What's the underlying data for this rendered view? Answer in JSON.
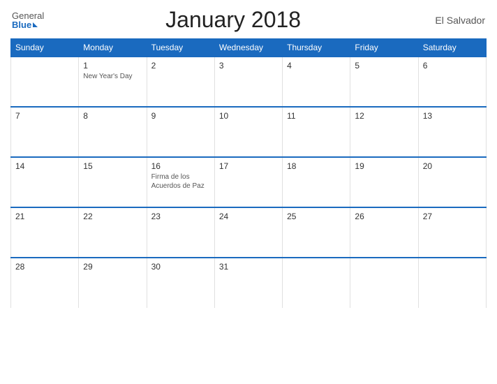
{
  "header": {
    "logo_general": "General",
    "logo_blue": "Blue",
    "title": "January 2018",
    "country": "El Salvador"
  },
  "days_of_week": [
    "Sunday",
    "Monday",
    "Tuesday",
    "Wednesday",
    "Thursday",
    "Friday",
    "Saturday"
  ],
  "weeks": [
    [
      {
        "day": "",
        "holiday": "",
        "empty": true
      },
      {
        "day": "1",
        "holiday": "New Year's Day",
        "empty": false
      },
      {
        "day": "2",
        "holiday": "",
        "empty": false
      },
      {
        "day": "3",
        "holiday": "",
        "empty": false
      },
      {
        "day": "4",
        "holiday": "",
        "empty": false
      },
      {
        "day": "5",
        "holiday": "",
        "empty": false
      },
      {
        "day": "6",
        "holiday": "",
        "empty": false
      }
    ],
    [
      {
        "day": "7",
        "holiday": "",
        "empty": false
      },
      {
        "day": "8",
        "holiday": "",
        "empty": false
      },
      {
        "day": "9",
        "holiday": "",
        "empty": false
      },
      {
        "day": "10",
        "holiday": "",
        "empty": false
      },
      {
        "day": "11",
        "holiday": "",
        "empty": false
      },
      {
        "day": "12",
        "holiday": "",
        "empty": false
      },
      {
        "day": "13",
        "holiday": "",
        "empty": false
      }
    ],
    [
      {
        "day": "14",
        "holiday": "",
        "empty": false
      },
      {
        "day": "15",
        "holiday": "",
        "empty": false
      },
      {
        "day": "16",
        "holiday": "Firma de los Acuerdos de Paz",
        "empty": false
      },
      {
        "day": "17",
        "holiday": "",
        "empty": false
      },
      {
        "day": "18",
        "holiday": "",
        "empty": false
      },
      {
        "day": "19",
        "holiday": "",
        "empty": false
      },
      {
        "day": "20",
        "holiday": "",
        "empty": false
      }
    ],
    [
      {
        "day": "21",
        "holiday": "",
        "empty": false
      },
      {
        "day": "22",
        "holiday": "",
        "empty": false
      },
      {
        "day": "23",
        "holiday": "",
        "empty": false
      },
      {
        "day": "24",
        "holiday": "",
        "empty": false
      },
      {
        "day": "25",
        "holiday": "",
        "empty": false
      },
      {
        "day": "26",
        "holiday": "",
        "empty": false
      },
      {
        "day": "27",
        "holiday": "",
        "empty": false
      }
    ],
    [
      {
        "day": "28",
        "holiday": "",
        "empty": false
      },
      {
        "day": "29",
        "holiday": "",
        "empty": false
      },
      {
        "day": "30",
        "holiday": "",
        "empty": false
      },
      {
        "day": "31",
        "holiday": "",
        "empty": false
      },
      {
        "day": "",
        "holiday": "",
        "empty": true
      },
      {
        "day": "",
        "holiday": "",
        "empty": true
      },
      {
        "day": "",
        "holiday": "",
        "empty": true
      }
    ]
  ]
}
